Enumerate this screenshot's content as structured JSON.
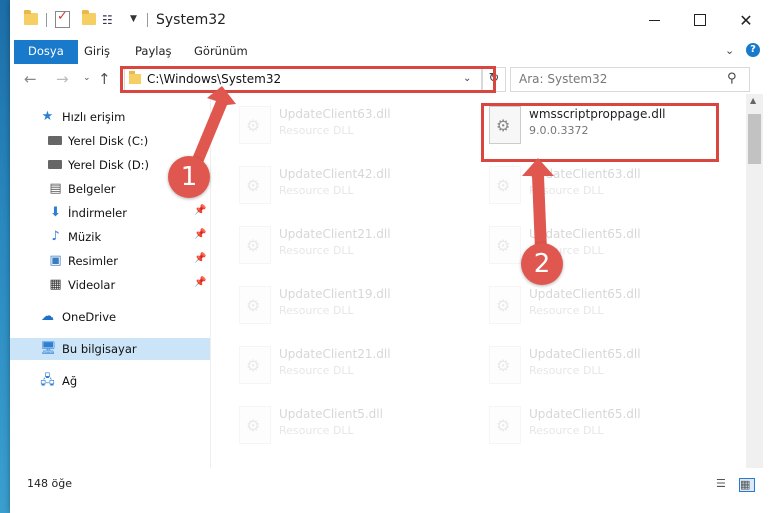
{
  "window": {
    "title": "System32",
    "controls": {
      "minimize": "",
      "maximize": "",
      "close": "✕"
    }
  },
  "ribbon": {
    "tabs": [
      "Dosya",
      "Giriş",
      "Paylaş",
      "Görünüm"
    ]
  },
  "navigation": {
    "address": "C:\\Windows\\System32",
    "search_placeholder": "Ara: System32"
  },
  "sidebar": {
    "items": [
      {
        "label": "Hızlı erişim",
        "icon": "star-icon"
      },
      {
        "label": "Yerel Disk (C:)",
        "icon": "drive-icon"
      },
      {
        "label": "Yerel Disk (D:)",
        "icon": "drive-icon"
      },
      {
        "label": "Belgeler",
        "icon": "documents-icon"
      },
      {
        "label": "İndirmeler",
        "icon": "download-icon"
      },
      {
        "label": "Müzik",
        "icon": "music-icon"
      },
      {
        "label": "Resimler",
        "icon": "pictures-icon"
      },
      {
        "label": "Videolar",
        "icon": "video-icon"
      },
      {
        "label": "OneDrive",
        "icon": "cloud-icon"
      },
      {
        "label": "Bu bilgisayar",
        "icon": "computer-icon"
      },
      {
        "label": "Ağ",
        "icon": "network-icon"
      }
    ]
  },
  "files": [
    {
      "name": "UpdateClient63.dll",
      "type": "Resource DLL"
    },
    {
      "name": "wmsscriptproppage.dll",
      "type": "9.0.0.3372"
    },
    {
      "name": "UpdateClient42.dll",
      "type": "Resource DLL"
    },
    {
      "name": "UpdateClient63.dll",
      "type": "Resource DLL"
    },
    {
      "name": "UpdateClient21.dll",
      "type": "Resource DLL"
    },
    {
      "name": "UpdateClient65.dll",
      "type": "Resource DLL"
    },
    {
      "name": "UpdateClient19.dll",
      "type": "Resource DLL"
    },
    {
      "name": "UpdateClient65.dll",
      "type": "Resource DLL"
    },
    {
      "name": "UpdateClient21.dll",
      "type": "Resource DLL"
    },
    {
      "name": "UpdateClient65.dll",
      "type": "Resource DLL"
    },
    {
      "name": "UpdateClient5.dll",
      "type": "Resource DLL"
    },
    {
      "name": "UpdateClient65.dll",
      "type": "Resource DLL"
    }
  ],
  "status": {
    "item_count": "148 öğe"
  },
  "annotations": {
    "badge1": "1",
    "badge2": "2",
    "highlight_color": "#d9463f",
    "badge_color": "#e0574f"
  }
}
